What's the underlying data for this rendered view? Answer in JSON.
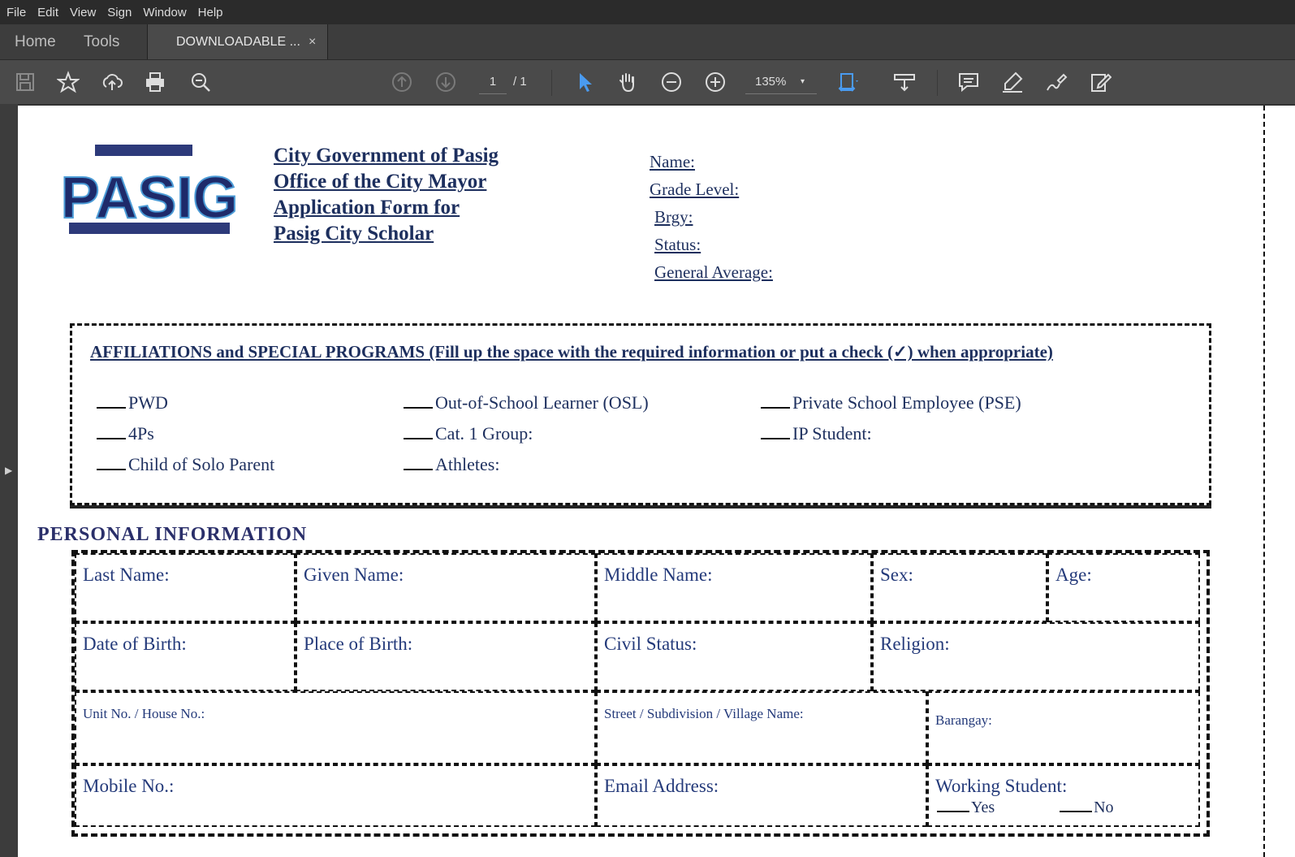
{
  "menu": [
    "File",
    "Edit",
    "View",
    "Sign",
    "Window",
    "Help"
  ],
  "tabs": {
    "home": "Home",
    "tools": "Tools",
    "document": "DOWNLOADABLE ...",
    "close": "×"
  },
  "toolbar": {
    "page_current": "1",
    "page_total": "/ 1",
    "zoom": "135%",
    "zoom_caret": "▾",
    "accent": "#4a9bf0"
  },
  "sidebar": {
    "toggle": "▶"
  },
  "doc": {
    "logo_text": "PASIG",
    "header_lines": [
      "City Government of Pasig",
      "Office of the City Mayor",
      "Application Form for",
      "Pasig City Scholar"
    ],
    "summary": [
      "Name:",
      "Grade Level:",
      "Brgy:",
      "Status:",
      "General Average:"
    ],
    "affiliation_title": "AFFILIATIONS and SPECIAL PROGRAMS (Fill up the space with the required information or put a check (✓) when appropriate)",
    "affiliations": [
      [
        "PWD",
        "Child of Solo Parent",
        "4Ps"
      ],
      [
        "Out-of-School Learner (OSL)",
        "Cat. 1 Group:",
        "Athletes:"
      ],
      [
        "Private School Employee (PSE)",
        "IP Student:"
      ]
    ],
    "personal_title": "PERSONAL INFORMATION",
    "fields": {
      "last_name": "Last Name:",
      "given_name": "Given Name:",
      "middle_name": "Middle Name:",
      "sex": "Sex:",
      "age": "Age:",
      "dob": "Date of Birth:",
      "pob": "Place of Birth:",
      "civil": "Civil Status:",
      "religion": "Religion:",
      "unit": "Unit No. / House No.:",
      "street": "Street / Subdivision / Village Name:",
      "barangay": "Barangay:",
      "mobile": "Mobile No.:",
      "email": "Email Address:",
      "working": "Working Student:",
      "yes": "Yes",
      "no": "No"
    }
  }
}
